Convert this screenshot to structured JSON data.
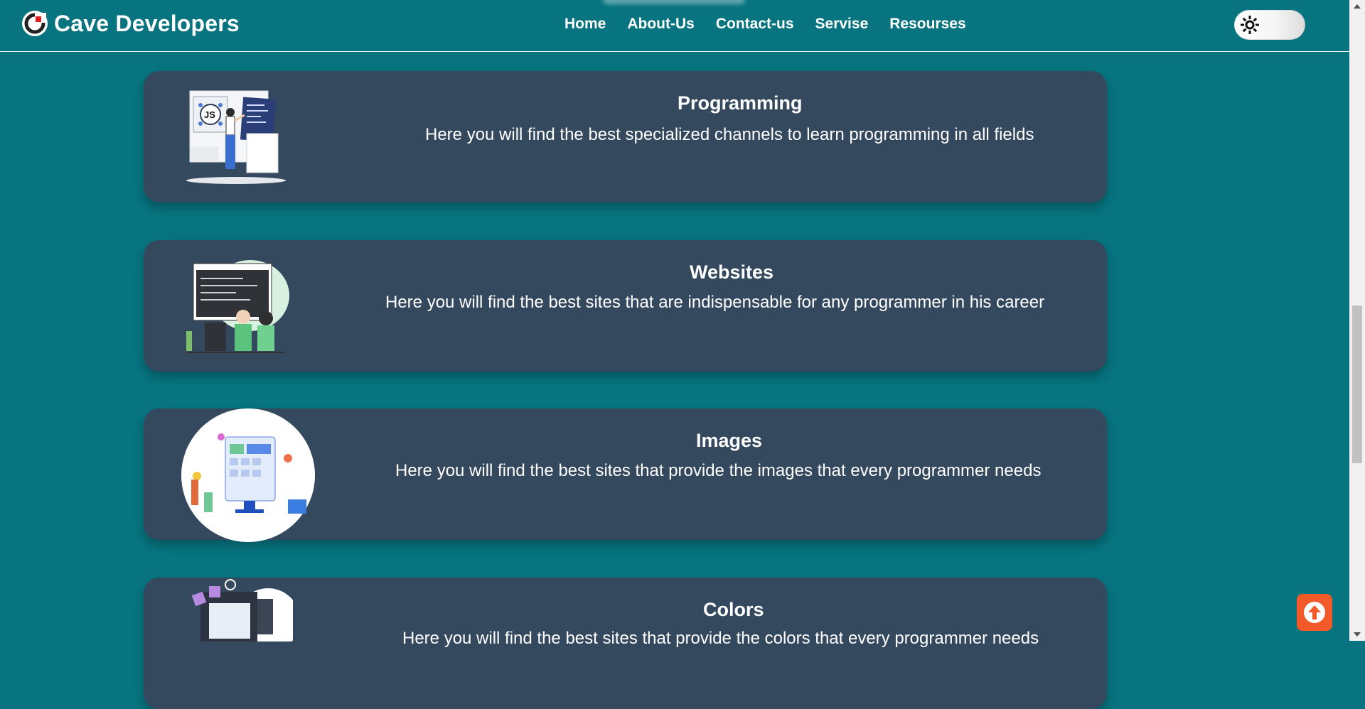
{
  "brand": {
    "title": "Cave Developers"
  },
  "nav": {
    "home": "Home",
    "about": "About-Us",
    "contact": "Contact-us",
    "service": "Servise",
    "resources": "Resourses"
  },
  "theme_toggle": {
    "icon": "sun-icon"
  },
  "cards": [
    {
      "title": "Programming",
      "text": "Here you will find the best specialized channels to learn programming in all fields"
    },
    {
      "title": "Websites",
      "text": "Here you will find the best sites that are indispensable for any programmer in his career"
    },
    {
      "title": "Images",
      "text": "Here you will find the best sites that provide the images that every programmer needs"
    },
    {
      "title": "Colors",
      "text": "Here you will find the best sites that provide the colors that every programmer needs"
    }
  ],
  "colors": {
    "page_bg": "#07747f",
    "card_bg": "#34495e",
    "to_top_button": "#f25a29"
  }
}
